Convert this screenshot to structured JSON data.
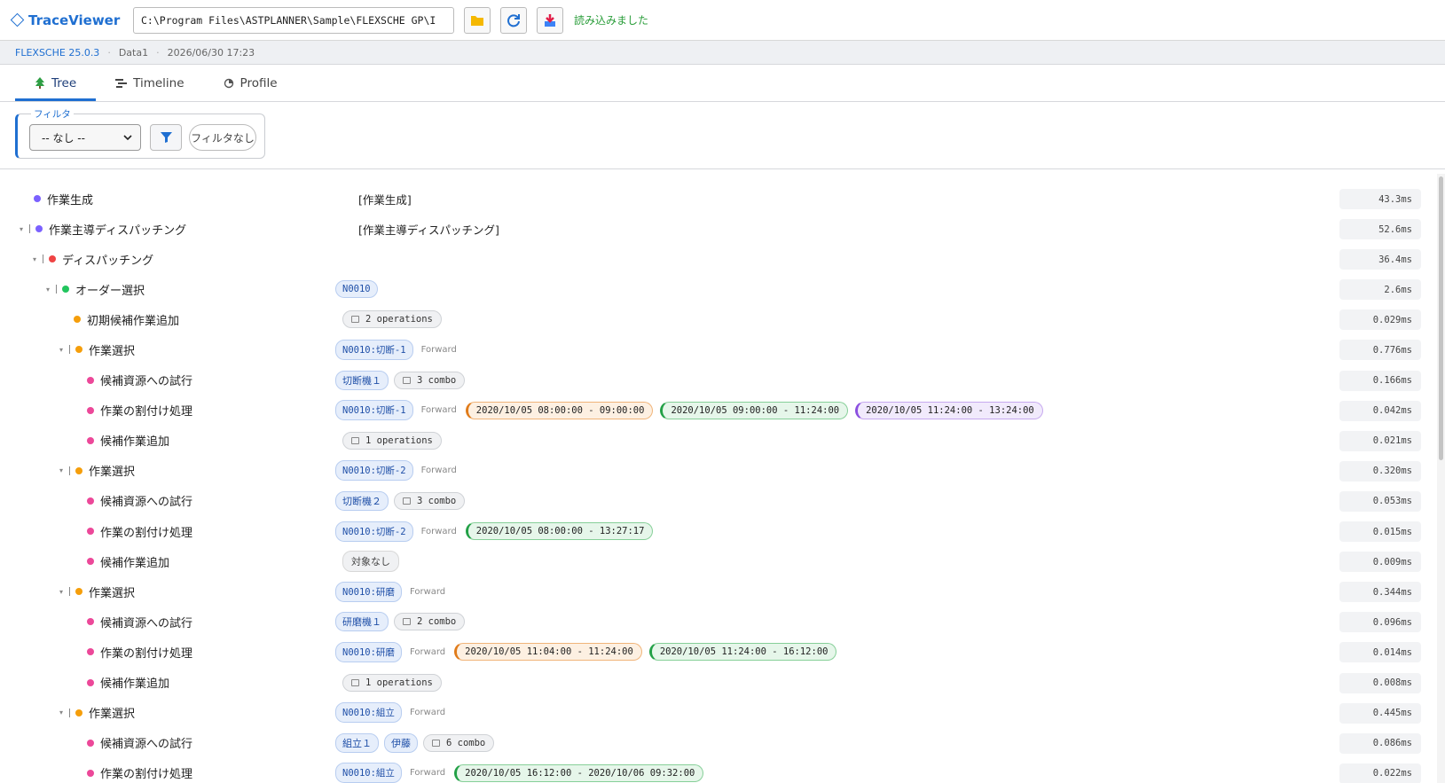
{
  "header": {
    "app_title": "TraceViewer",
    "file_path": "C:\\Program Files\\ASTPLANNER\\Sample\\FLEXSCHE GP\\I",
    "status_message": "読み込みました",
    "accent_color": "#1f6fd1"
  },
  "infobar": {
    "version": "FLEXSCHE 25.0.3",
    "data_name": "Data1",
    "timestamp": "2026/06/30 17:23"
  },
  "tabs": [
    {
      "label": "Tree",
      "icon": "tree-icon",
      "active": true
    },
    {
      "label": "Timeline",
      "icon": "timeline-icon",
      "active": false
    },
    {
      "label": "Profile",
      "icon": "profile-clock-icon",
      "active": false
    }
  ],
  "filter": {
    "legend": "フィルタ",
    "selected": "-- なし --",
    "clear_label": "フィルタなし"
  },
  "tree_rows": [
    {
      "name": "作業生成",
      "level": 0,
      "expandable": false,
      "color": "#7b61ff",
      "duration": "43.3ms",
      "body": [
        {
          "t": "plain",
          "text": "[作業生成]"
        }
      ]
    },
    {
      "name": "作業主導ディスパッチング",
      "level": 0,
      "expandable": true,
      "color": "#7b61ff",
      "duration": "52.6ms",
      "body": [
        {
          "t": "plain",
          "text": "[作業主導ディスパッチング]"
        }
      ]
    },
    {
      "name": "ディスパッチング",
      "level": 1,
      "expandable": true,
      "color": "#ef4444",
      "duration": "36.4ms",
      "body": []
    },
    {
      "name": "オーダー選択",
      "level": 2,
      "expandable": true,
      "color": "#22c55e",
      "duration": "2.6ms",
      "body": [
        {
          "t": "ord",
          "text": "N0010"
        }
      ]
    },
    {
      "name": "初期候補作業追加",
      "level": 3,
      "expandable": false,
      "color": "#f59e0b",
      "duration": "0.029ms",
      "body": [
        {
          "t": "cnt",
          "text": "2 operations"
        }
      ]
    },
    {
      "name": "作業選択",
      "level": 3,
      "expandable": true,
      "color": "#f59e0b",
      "duration": "0.776ms",
      "body": [
        {
          "t": "ord",
          "text": "N0010:切断-1"
        },
        {
          "t": "dir",
          "text": "Forward"
        }
      ]
    },
    {
      "name": "候補資源への試行",
      "level": 4,
      "expandable": false,
      "color": "#ec4899",
      "duration": "0.166ms",
      "body": [
        {
          "t": "res",
          "text": "切断機１"
        },
        {
          "t": "cnt",
          "text": "3 combo"
        }
      ]
    },
    {
      "name": "作業の割付け処理",
      "level": 4,
      "expandable": false,
      "color": "#ec4899",
      "duration": "0.042ms",
      "body": [
        {
          "t": "ord",
          "text": "N0010:切断-1"
        },
        {
          "t": "dir",
          "text": "Forward"
        },
        {
          "t": "time",
          "text": "2020/10/05 08:00:00 - 09:00:00",
          "c": "orange"
        },
        {
          "t": "time",
          "text": "2020/10/05 09:00:00 - 11:24:00",
          "c": "green"
        },
        {
          "t": "time",
          "text": "2020/10/05 11:24:00 - 13:24:00",
          "c": "purple"
        }
      ]
    },
    {
      "name": "候補作業追加",
      "level": 4,
      "expandable": false,
      "color": "#ec4899",
      "duration": "0.021ms",
      "body": [
        {
          "t": "cnt",
          "text": "1 operations"
        }
      ]
    },
    {
      "name": "作業選択",
      "level": 3,
      "expandable": true,
      "color": "#f59e0b",
      "duration": "0.320ms",
      "body": [
        {
          "t": "ord",
          "text": "N0010:切断-2"
        },
        {
          "t": "dir",
          "text": "Forward"
        }
      ]
    },
    {
      "name": "候補資源への試行",
      "level": 4,
      "expandable": false,
      "color": "#ec4899",
      "duration": "0.053ms",
      "body": [
        {
          "t": "res",
          "text": "切断機２"
        },
        {
          "t": "cnt",
          "text": "3 combo"
        }
      ]
    },
    {
      "name": "作業の割付け処理",
      "level": 4,
      "expandable": false,
      "color": "#ec4899",
      "duration": "0.015ms",
      "body": [
        {
          "t": "ord",
          "text": "N0010:切断-2"
        },
        {
          "t": "dir",
          "text": "Forward"
        },
        {
          "t": "time",
          "text": "2020/10/05 08:00:00 - 13:27:17",
          "c": "green"
        }
      ]
    },
    {
      "name": "候補作業追加",
      "level": 4,
      "expandable": false,
      "color": "#ec4899",
      "duration": "0.009ms",
      "body": [
        {
          "t": "none",
          "text": "対象なし"
        }
      ]
    },
    {
      "name": "作業選択",
      "level": 3,
      "expandable": true,
      "color": "#f59e0b",
      "duration": "0.344ms",
      "body": [
        {
          "t": "ord",
          "text": "N0010:研磨"
        },
        {
          "t": "dir",
          "text": "Forward"
        }
      ]
    },
    {
      "name": "候補資源への試行",
      "level": 4,
      "expandable": false,
      "color": "#ec4899",
      "duration": "0.096ms",
      "body": [
        {
          "t": "res",
          "text": "研磨機１"
        },
        {
          "t": "cnt",
          "text": "2 combo"
        }
      ]
    },
    {
      "name": "作業の割付け処理",
      "level": 4,
      "expandable": false,
      "color": "#ec4899",
      "duration": "0.014ms",
      "body": [
        {
          "t": "ord",
          "text": "N0010:研磨"
        },
        {
          "t": "dir",
          "text": "Forward"
        },
        {
          "t": "time",
          "text": "2020/10/05 11:04:00 - 11:24:00",
          "c": "orange"
        },
        {
          "t": "time",
          "text": "2020/10/05 11:24:00 - 16:12:00",
          "c": "green"
        }
      ]
    },
    {
      "name": "候補作業追加",
      "level": 4,
      "expandable": false,
      "color": "#ec4899",
      "duration": "0.008ms",
      "body": [
        {
          "t": "cnt",
          "text": "1 operations"
        }
      ]
    },
    {
      "name": "作業選択",
      "level": 3,
      "expandable": true,
      "color": "#f59e0b",
      "duration": "0.445ms",
      "body": [
        {
          "t": "ord",
          "text": "N0010:組立"
        },
        {
          "t": "dir",
          "text": "Forward"
        }
      ]
    },
    {
      "name": "候補資源への試行",
      "level": 4,
      "expandable": false,
      "color": "#ec4899",
      "duration": "0.086ms",
      "body": [
        {
          "t": "res",
          "text": "組立１"
        },
        {
          "t": "res",
          "text": "伊藤"
        },
        {
          "t": "cnt",
          "text": "6 combo"
        }
      ]
    },
    {
      "name": "作業の割付け処理",
      "level": 4,
      "expandable": false,
      "color": "#ec4899",
      "duration": "0.022ms",
      "body": [
        {
          "t": "ord",
          "text": "N0010:組立"
        },
        {
          "t": "dir",
          "text": "Forward"
        },
        {
          "t": "time",
          "text": "2020/10/05 16:12:00 - 2020/10/06 09:32:00",
          "c": "green"
        }
      ]
    }
  ],
  "time_colors": {
    "orange": {
      "bg": "#fdf0e2",
      "border": "#f0b479",
      "accent": "#e07b1a"
    },
    "green": {
      "bg": "#e6f6ea",
      "border": "#86cf98",
      "accent": "#22a046"
    },
    "purple": {
      "bg": "#f1eafc",
      "border": "#c6a9ef",
      "accent": "#8b4fe0"
    }
  }
}
